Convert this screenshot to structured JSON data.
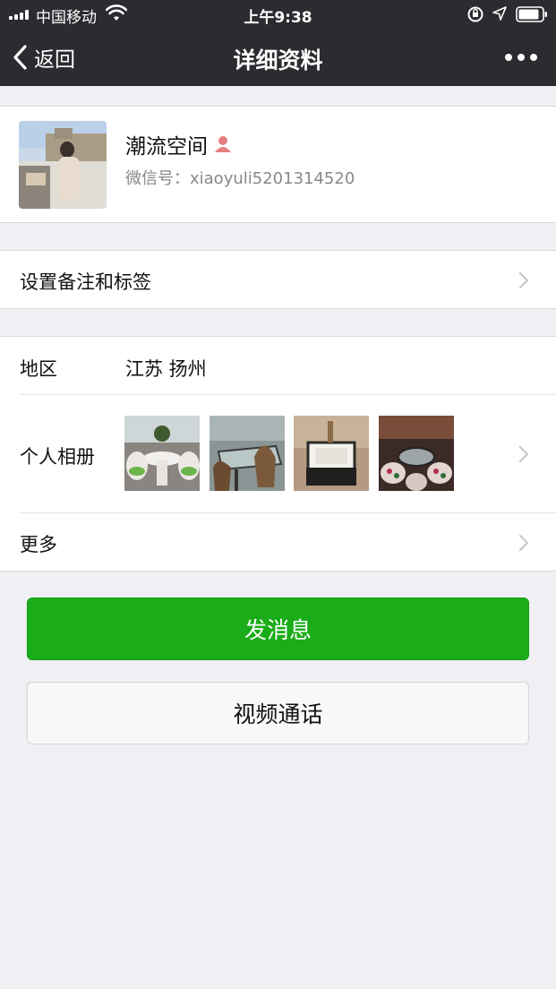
{
  "status_bar": {
    "carrier": "中国移动",
    "time": "上午9:38"
  },
  "nav": {
    "back_label": "返回",
    "title": "详细资料"
  },
  "profile": {
    "nickname": "潮流空间",
    "wechat_id": "微信号：xiaoyuli5201314520"
  },
  "remark_row": {
    "label": "设置备注和标签"
  },
  "info": {
    "region_label": "地区",
    "region_value": "江苏 扬州",
    "album_label": "个人相册",
    "more_label": "更多"
  },
  "actions": {
    "send_message": "发消息",
    "video_call": "视频通话"
  },
  "colors": {
    "nav_bg": "#2b2b30",
    "primary_green": "#1aad19",
    "page_bg": "#efeff4"
  }
}
